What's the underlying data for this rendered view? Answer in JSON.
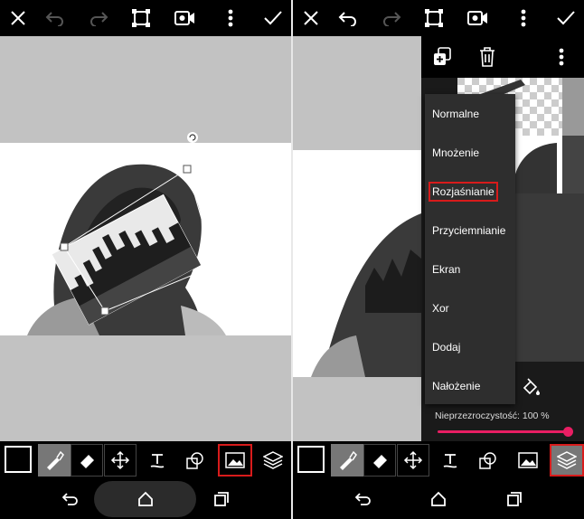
{
  "colors": {
    "accent": "#e91e63",
    "highlight": "#d81b1b",
    "canvas_bg": "#c2c2c2",
    "menu_bg": "#2e2e2e"
  },
  "left_panel": {
    "topbar_icons": [
      "close-icon",
      "undo-icon",
      "redo-icon",
      "crop-frame-icon",
      "video-camera-icon",
      "more-vertical-icon",
      "check-icon"
    ],
    "tools": [
      "color-swatch",
      "brush-tool-icon",
      "eraser-tool-icon",
      "move-tool-icon",
      "text-tool-icon",
      "shape-tool-icon",
      "add-photo-icon",
      "layers-icon"
    ],
    "selected_tool": "add-photo-icon"
  },
  "right_panel": {
    "topbar_icons": [
      "close-icon",
      "undo-icon",
      "redo-icon",
      "crop-frame-icon",
      "video-camera-icon",
      "more-vertical-icon",
      "check-icon"
    ],
    "layer_actions": [
      "duplicate-layer-icon",
      "delete-layer-icon",
      "more-vertical-icon"
    ],
    "blend_modes": [
      "Normalne",
      "Mnożenie",
      "Rozjaśnianie",
      "Przyciemnianie",
      "Ekran",
      "Xor",
      "Dodaj",
      "Nałożenie"
    ],
    "selected_blend": "Rozjaśnianie",
    "opacity_label": "Nieprzezroczystość: 100 %",
    "opacity_value": 1.0,
    "selected_tool": "layers-icon"
  },
  "navbar_icons": [
    "back-icon",
    "home-icon",
    "recents-icon"
  ]
}
